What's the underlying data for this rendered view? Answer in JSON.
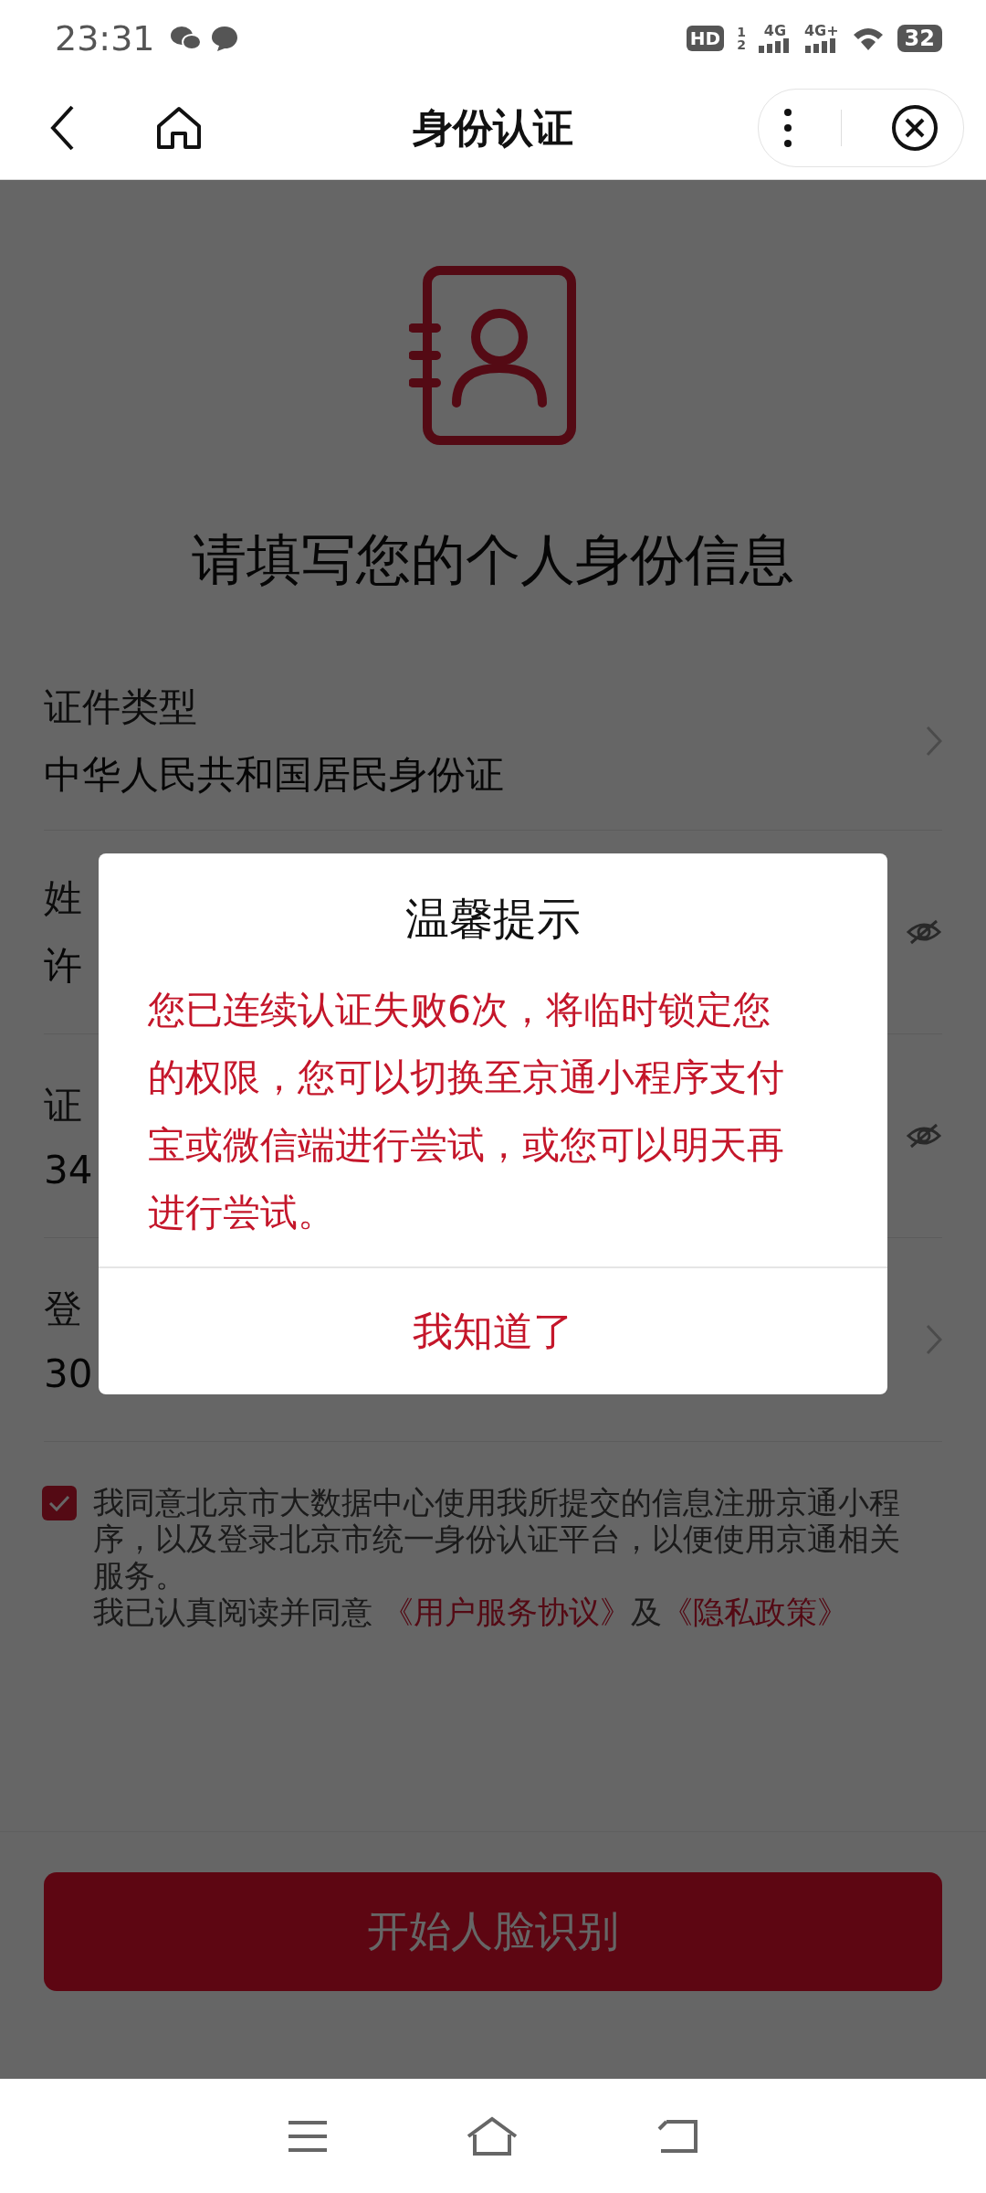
{
  "status_bar": {
    "time": "23:31",
    "hd": "HD",
    "sims": [
      "1",
      "2"
    ],
    "networks": [
      "4G",
      "4G+"
    ],
    "battery": "32"
  },
  "nav": {
    "title": "身份认证"
  },
  "heading": "请填写您的个人身份信息",
  "fields": [
    {
      "label": "证件类型",
      "value": "中华人民共和国居民身份证",
      "kind": "select"
    },
    {
      "label": "姓",
      "value": "许",
      "kind": "masked"
    },
    {
      "label": "证",
      "value": "34",
      "kind": "masked"
    },
    {
      "label": "登",
      "value": "30",
      "kind": "select"
    }
  ],
  "agreement": {
    "checked": true,
    "text": "我同意北京市大数据中心使用我所提交的信息注册京通小程序，以及登录北京市统一身份认证平台，以便使用京通相关服务。",
    "read_prefix": "我已认真阅读并同意 ",
    "links": [
      "《用户服务协议》",
      "《隐私政策》"
    ],
    "joiner": "及"
  },
  "start_button": "开始人脸识别",
  "dialog": {
    "title": "温馨提示",
    "message": "您已连续认证失败6次，将临时锁定您的权限，您可以切换至京通小程序支付宝或微信端进行尝试，或您可以明天再进行尝试。",
    "button": "我知道了"
  }
}
